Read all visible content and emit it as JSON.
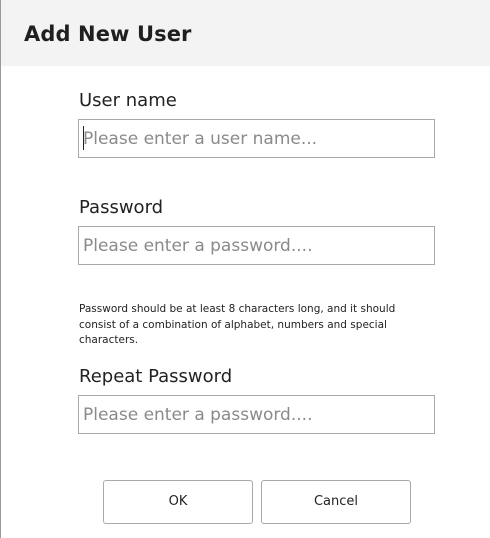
{
  "dialog": {
    "title": "Add New User"
  },
  "username": {
    "label": "User name",
    "value": "",
    "placeholder": "Please enter a user name..."
  },
  "password": {
    "label": "Password",
    "value": "",
    "placeholder": "Please enter a password...."
  },
  "password_hint": "Password should be at least 8 characters long, and it should consist of a combination of alphabet, numbers and special characters.",
  "repeat_password": {
    "label": "Repeat Password",
    "value": "",
    "placeholder": "Please enter a password...."
  },
  "buttons": {
    "ok_label": "OK",
    "cancel_label": "Cancel"
  }
}
